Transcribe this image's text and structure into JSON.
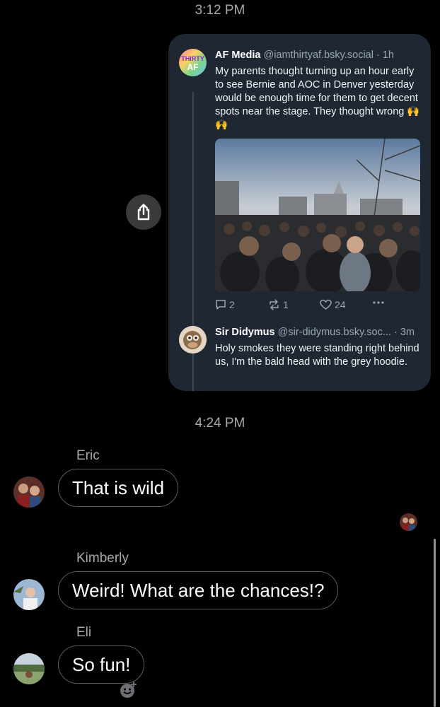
{
  "timestamps": {
    "first": "3:12 PM",
    "second": "4:24 PM"
  },
  "shared_post": {
    "author": "AF Media",
    "handle": "@iamthirtyaf.bsky.social",
    "age": "· 1h",
    "avatar_text": "THIRTY AF",
    "text": "My parents thought turning up an hour early to see Bernie and AOC in Denver yesterday would be enough time for them to get decent spots near the stage. They thought wrong 🙌🙌",
    "stats": {
      "replies": "2",
      "reposts": "1",
      "likes": "24"
    },
    "reply": {
      "author": "Sir Didymus",
      "handle": "@sir-didymus.bsky.soc...",
      "age": "· 3m",
      "text": "Holy smokes they were standing right behind us, I'm the bald head with the grey hoodie."
    }
  },
  "messages": [
    {
      "sender": "Eric",
      "text": "That is wild"
    },
    {
      "sender": "Kimberly",
      "text": "Weird! What are the chances!?"
    },
    {
      "sender": "Eli",
      "text": "So fun!"
    }
  ],
  "colors": {
    "card_bg": "#1e2732",
    "bubble_border": "#5a5a5e",
    "muted": "#a9a9ad"
  }
}
